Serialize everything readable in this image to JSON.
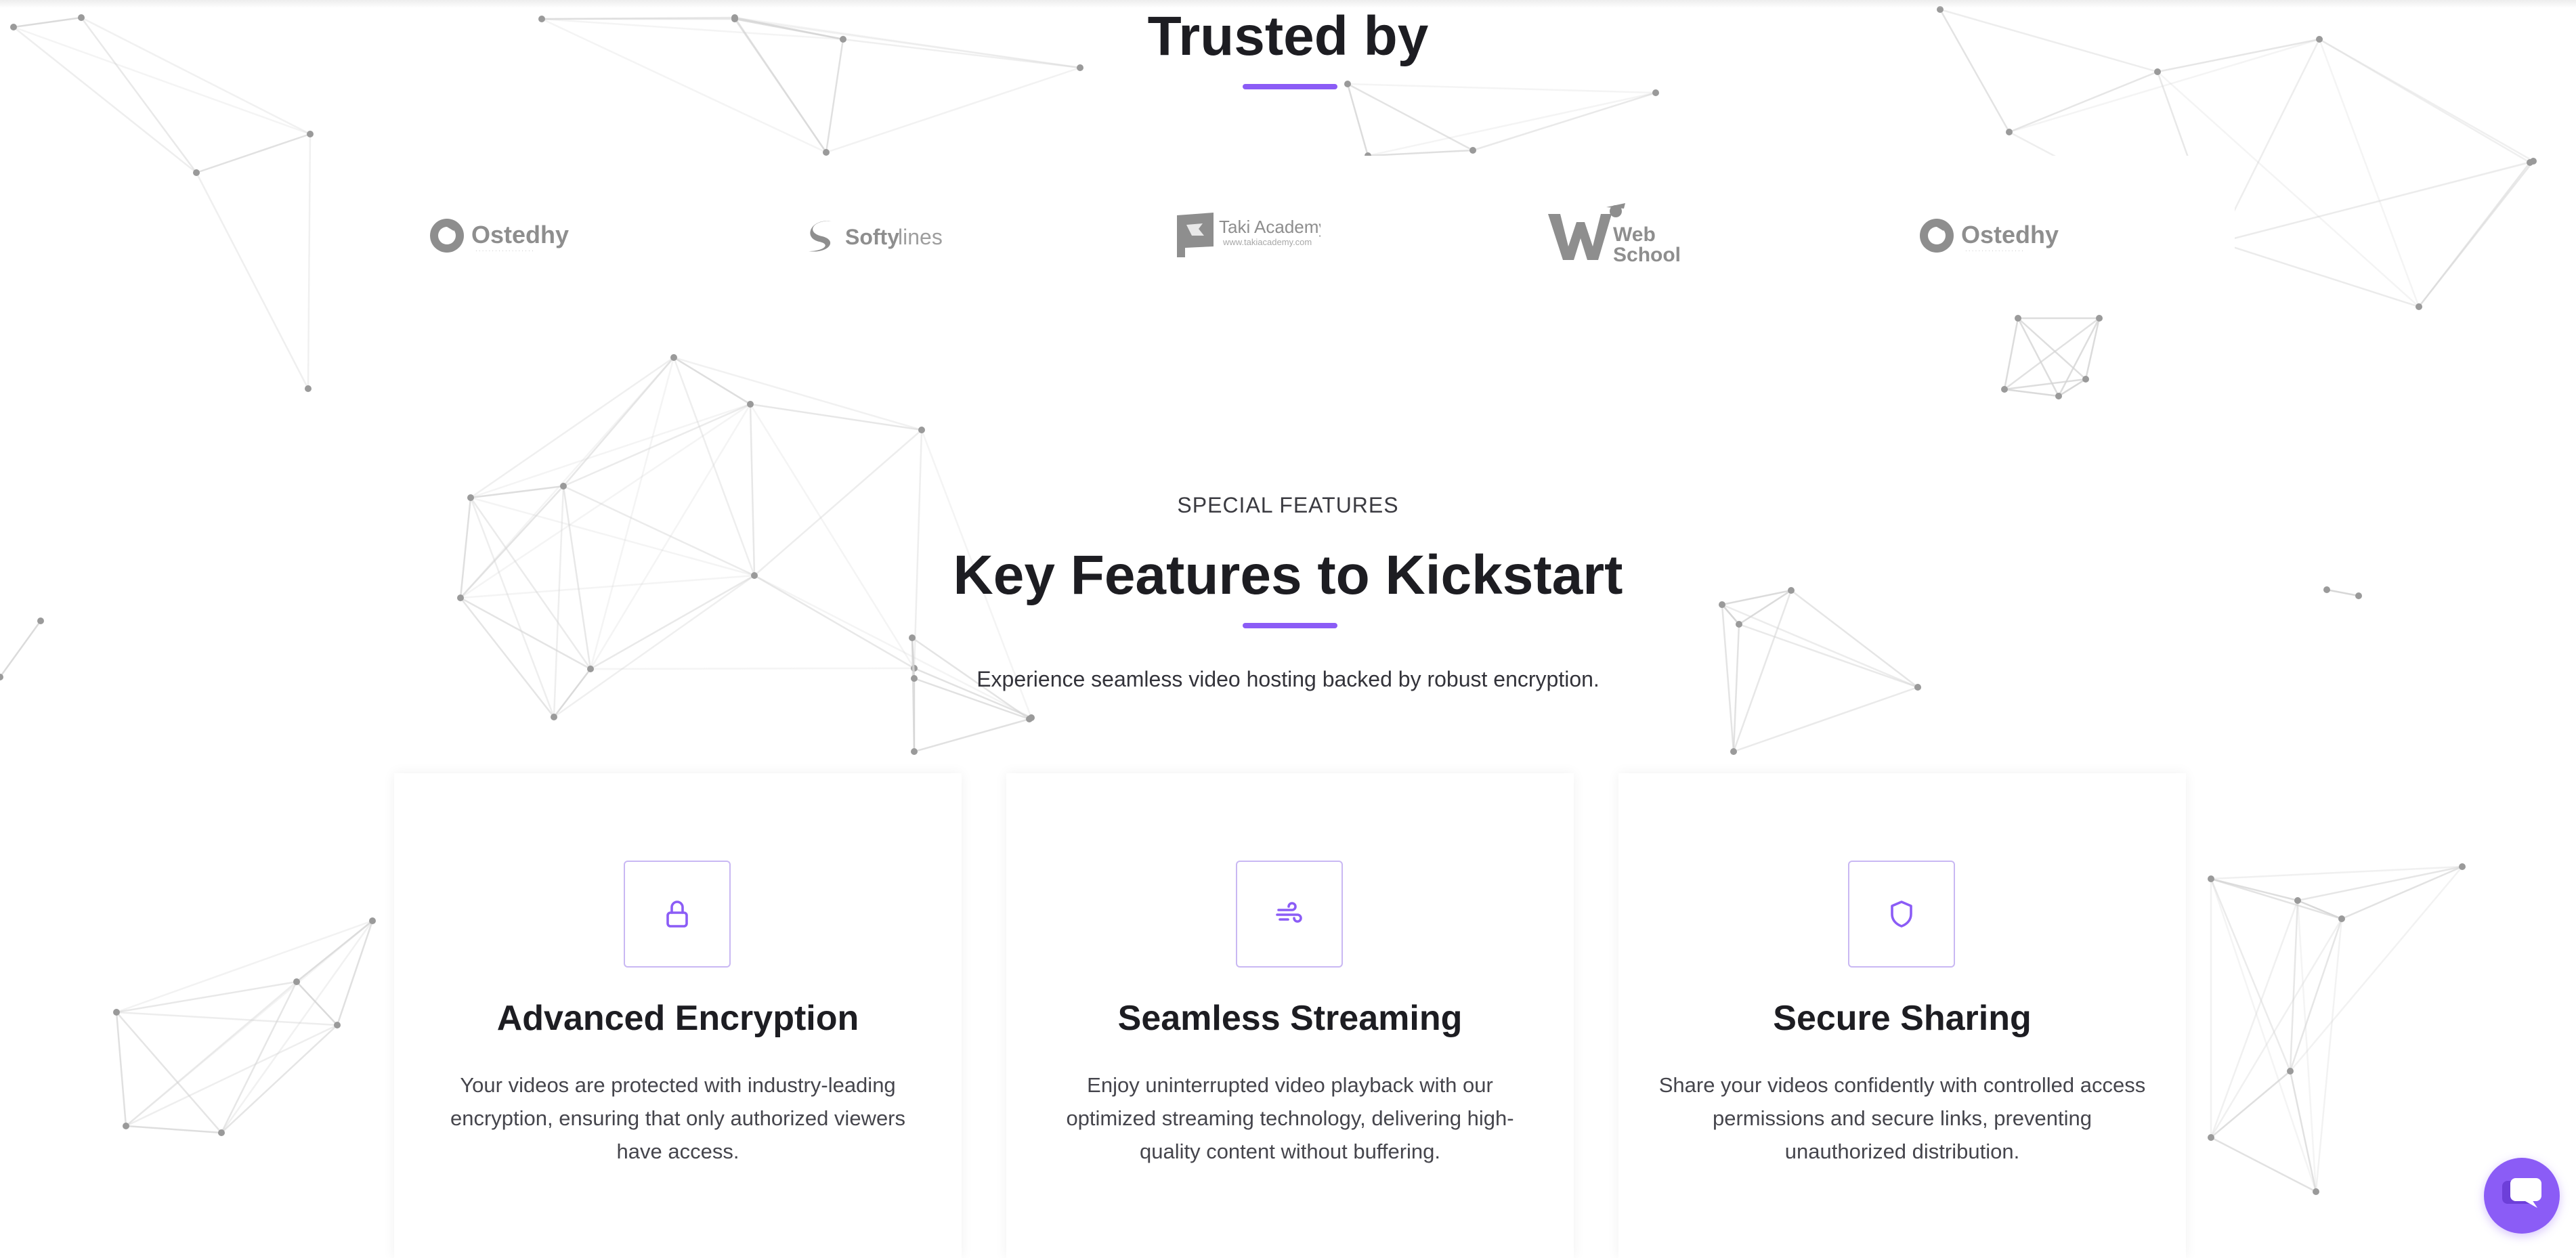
{
  "theme": {
    "accent": "#8b5cf6",
    "icon_border": "#c9b8f3",
    "network_line": "#d4d4d4",
    "network_node": "#9a9a9a",
    "logo_gray": "#8e8e8e"
  },
  "trusted": {
    "title": "Trusted by",
    "logos": [
      {
        "name": "Ostedhy",
        "icon": "ostedhy-logo"
      },
      {
        "name": "Softylines",
        "icon": "softylines-logo",
        "word_a": "Softy",
        "word_b": "lines"
      },
      {
        "name": "Taki Academy",
        "icon": "taki-academy-logo",
        "subtext": "www.takiacademy.com"
      },
      {
        "name": "Web School",
        "icon": "web-school-logo",
        "word_a": "Web",
        "word_b": "School"
      },
      {
        "name": "Ostedhy",
        "icon": "ostedhy-logo"
      }
    ]
  },
  "features": {
    "kicker": "SPECIAL FEATURES",
    "title": "Key Features to Kickstart",
    "subtitle": "Experience seamless video hosting backed by robust encryption.",
    "cards": [
      {
        "icon": "lock-icon",
        "title": "Advanced Encryption",
        "text": "Your videos are protected with industry-leading encryption, ensuring that only authorized viewers have access."
      },
      {
        "icon": "wind-icon",
        "title": "Seamless Streaming",
        "text": "Enjoy uninterrupted video playback with our optimized streaming technology, delivering high-quality content without buffering."
      },
      {
        "icon": "shield-icon",
        "title": "Secure Sharing",
        "text": "Share your videos confidently with controlled access permissions and secure links, preventing unauthorized distribution."
      }
    ]
  },
  "chat": {
    "icon": "chat-bubble-icon"
  }
}
